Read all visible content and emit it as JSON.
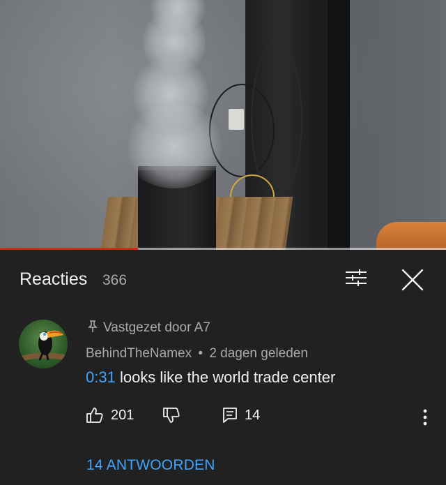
{
  "video": {
    "progress_fraction": 0.31
  },
  "comments_panel": {
    "title": "Reacties",
    "count": "366",
    "sort_icon": "sort-filter-icon",
    "close_icon": "close-icon"
  },
  "comment": {
    "pinned_label": "Vastgezet door A7",
    "author": "BehindTheNamex",
    "separator": "•",
    "time_ago": "2 dagen geleden",
    "timestamp": "0:31",
    "text": " looks like the world trade center",
    "likes": "201",
    "replies_count": "14",
    "replies_link": "14 ANTWOORDEN"
  },
  "colors": {
    "background": "#212121",
    "link": "#3ea6ff",
    "progress": "#e62117",
    "secondary_text": "#aaaaaa"
  }
}
